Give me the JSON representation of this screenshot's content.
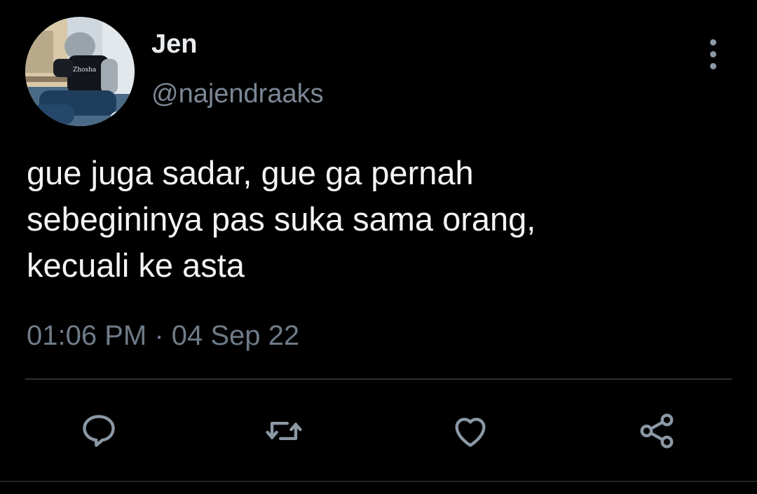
{
  "tweet": {
    "author": {
      "display_name": "Jen",
      "handle": "@najendraaks",
      "avatar_icon": "profile-photo"
    },
    "text": "gue juga sadar, gue ga pernah\nsebegininya pas suka sama orang,\nkecuali ke asta",
    "timestamp": "01:06 PM · 04 Sep 22"
  },
  "actions": [
    {
      "name": "reply",
      "icon": "speech-bubble-icon"
    },
    {
      "name": "retweet",
      "icon": "retweet-arrows-icon"
    },
    {
      "name": "like",
      "icon": "heart-icon"
    },
    {
      "name": "share",
      "icon": "share-nodes-icon"
    }
  ],
  "colors": {
    "background": "#000000",
    "primary_text": "#f2f4f6",
    "secondary_text": "#6e7b88",
    "icon": "#8b98a5",
    "divider": "#2b3137"
  }
}
